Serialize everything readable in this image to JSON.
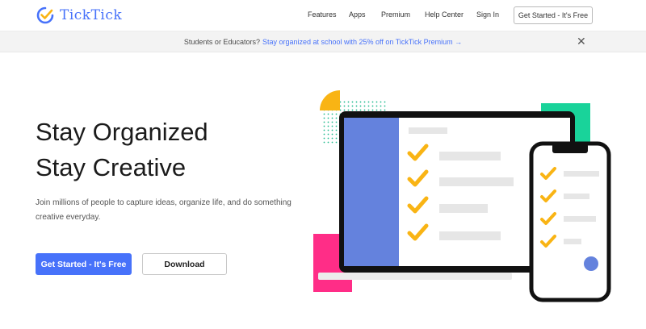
{
  "header": {
    "brand": "TickTick",
    "nav": [
      {
        "label": "Features"
      },
      {
        "label": "Apps"
      },
      {
        "label": "Premium"
      },
      {
        "label": "Help Center"
      },
      {
        "label": "Sign In"
      }
    ],
    "cta_label": "Get Started - It's Free"
  },
  "banner": {
    "text": "Students or Educators?",
    "link": "Stay organized at school with 25% off on TickTick Premium →",
    "close": "✕"
  },
  "hero": {
    "title_line1": "Stay Organized",
    "title_line2": "Stay Creative",
    "description": "Join millions of people to capture ideas, organize life, and do something creative everyday.",
    "primary_button": "Get Started - It's Free",
    "secondary_button": "Download"
  },
  "colors": {
    "brand_blue": "#4772fa",
    "sidebar_blue": "#6482dd",
    "check_yellow": "#f9b414",
    "accent_green": "#19d39a",
    "accent_pink": "#ff2d87",
    "device_black": "#111111"
  }
}
